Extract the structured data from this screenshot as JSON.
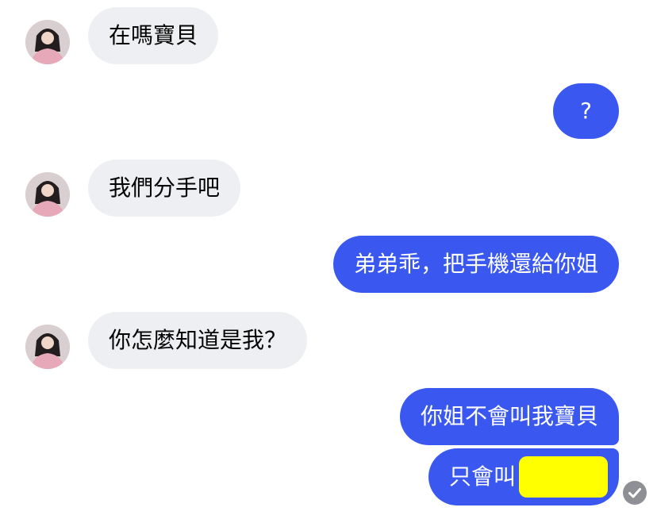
{
  "messages": [
    {
      "text": "在嗎寶貝"
    },
    {
      "text": "?"
    },
    {
      "text": "我們分手吧"
    },
    {
      "text": "弟弟乖，把手機還給你姐"
    },
    {
      "text": "你怎麼知道是我？"
    },
    {
      "text": "你姐不會叫我寶貝"
    },
    {
      "text": "只會叫"
    }
  ],
  "colors": {
    "sent_bubble": "#3a58f0",
    "received_bubble": "#eeeff2",
    "redaction": "#ffff00",
    "read_receipt": "#8e9096"
  },
  "icons": {
    "avatar": "profile-photo",
    "read_receipt": "check-circle-icon"
  }
}
